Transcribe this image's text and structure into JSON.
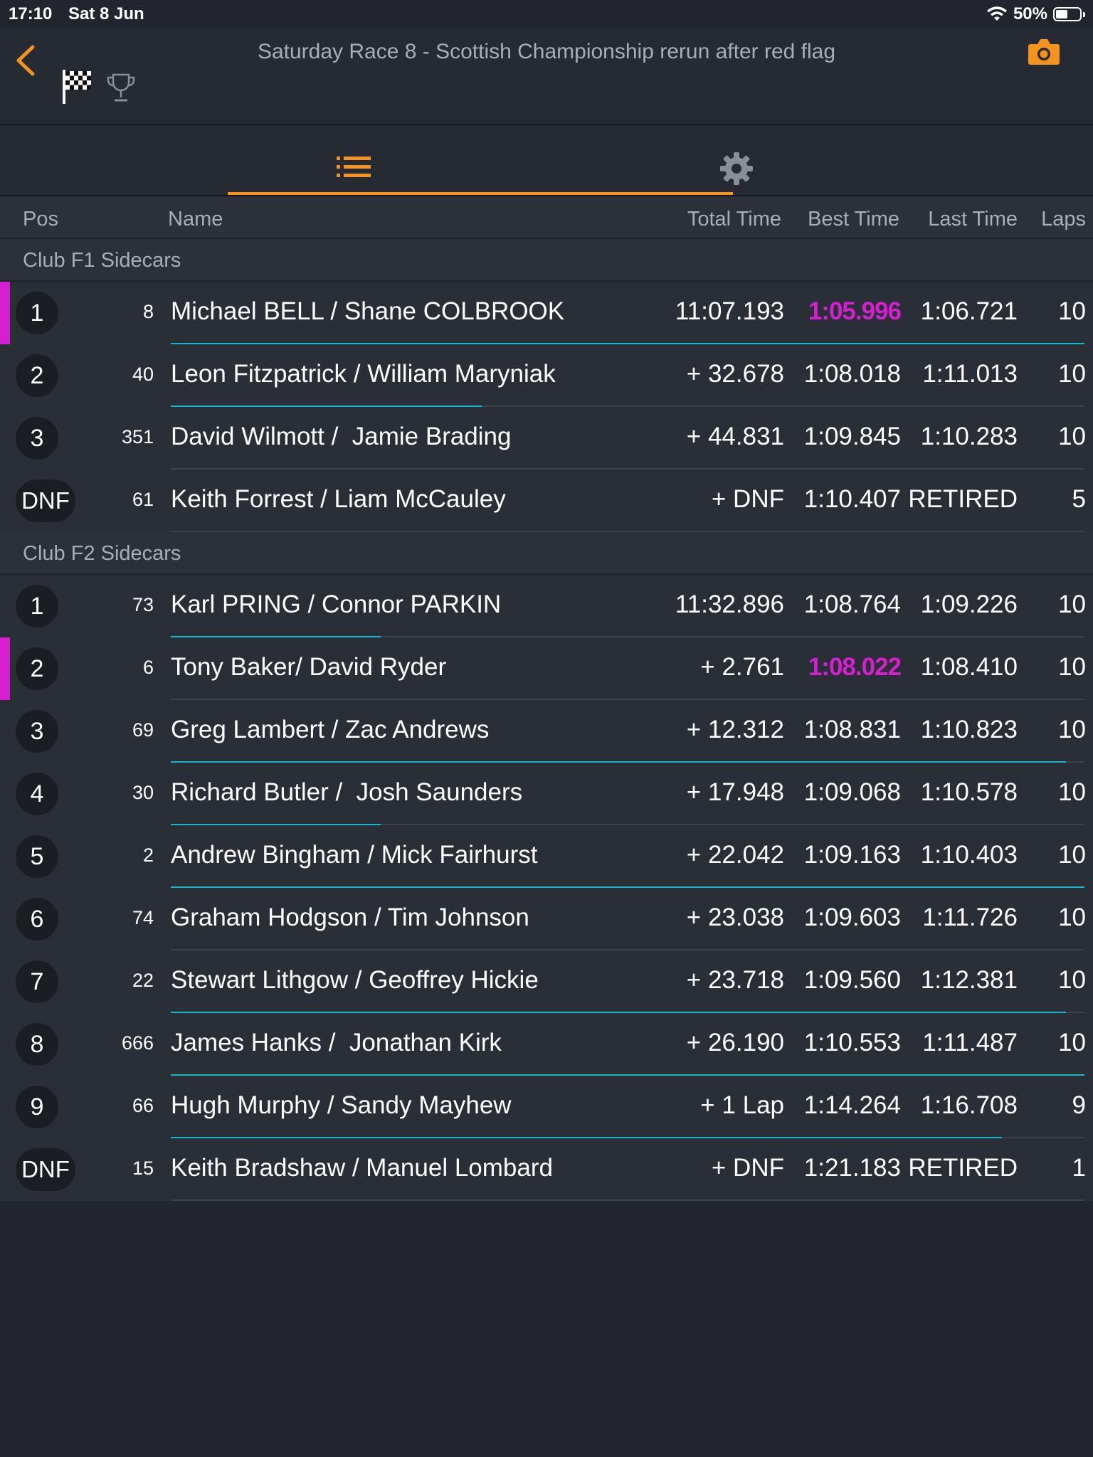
{
  "status": {
    "time": "17:10",
    "date": "Sat 8 Jun",
    "battery": "50%",
    "battery_level": 0.5
  },
  "header": {
    "title": "Saturday Race 8 - Scottish Championship rerun after red flag",
    "accent_color": "#f5931f"
  },
  "columns": {
    "pos": "Pos",
    "name": "Name",
    "total": "Total Time",
    "best": "Best Time",
    "last": "Last Time",
    "laps": "Laps"
  },
  "groups": [
    {
      "title": "Club F1 Sidecars",
      "rows": [
        {
          "pos": "1",
          "num": "8",
          "name": "Michael BELL / Shane COLBROOK",
          "total": "11:07.193",
          "best": "1:05.996",
          "fastest": true,
          "last": "1:06.721",
          "laps": "10",
          "progress": 1.0
        },
        {
          "pos": "2",
          "num": "40",
          "name": "Leon Fitzpatrick / William Maryniak",
          "total": "+ 32.678",
          "best": "1:08.018",
          "fastest": false,
          "last": "1:11.013",
          "laps": "10",
          "progress": 0.34
        },
        {
          "pos": "3",
          "num": "351",
          "name": "David Wilmott /  Jamie Brading",
          "total": "+ 44.831",
          "best": "1:09.845",
          "fastest": false,
          "last": "1:10.283",
          "laps": "10",
          "progress": 0.0
        },
        {
          "pos": "DNF",
          "num": "61",
          "name": "Keith Forrest / Liam McCauley",
          "total": "+ DNF",
          "best": "1:10.407",
          "fastest": false,
          "last": "RETIRED",
          "laps": "5",
          "progress": 0.0
        }
      ]
    },
    {
      "title": "Club F2 Sidecars",
      "rows": [
        {
          "pos": "1",
          "num": "73",
          "name": "Karl PRING / Connor PARKIN",
          "total": "11:32.896",
          "best": "1:08.764",
          "fastest": false,
          "last": "1:09.226",
          "laps": "10",
          "progress": 0.23
        },
        {
          "pos": "2",
          "num": "6",
          "name": "Tony Baker/ David Ryder",
          "total": "+ 2.761",
          "best": "1:08.022",
          "fastest": true,
          "last": "1:08.410",
          "laps": "10",
          "progress": 0.0
        },
        {
          "pos": "3",
          "num": "69",
          "name": "Greg Lambert / Zac Andrews",
          "total": "+ 12.312",
          "best": "1:08.831",
          "fastest": false,
          "last": "1:10.823",
          "laps": "10",
          "progress": 0.98
        },
        {
          "pos": "4",
          "num": "30",
          "name": "Richard Butler /  Josh Saunders",
          "total": "+ 17.948",
          "best": "1:09.068",
          "fastest": false,
          "last": "1:10.578",
          "laps": "10",
          "progress": 0.23
        },
        {
          "pos": "5",
          "num": "2",
          "name": "Andrew Bingham / Mick Fairhurst",
          "total": "+ 22.042",
          "best": "1:09.163",
          "fastest": false,
          "last": "1:10.403",
          "laps": "10",
          "progress": 1.0
        },
        {
          "pos": "6",
          "num": "74",
          "name": "Graham Hodgson / Tim Johnson",
          "total": "+ 23.038",
          "best": "1:09.603",
          "fastest": false,
          "last": "1:11.726",
          "laps": "10",
          "progress": 0.0
        },
        {
          "pos": "7",
          "num": "22",
          "name": "Stewart Lithgow / Geoffrey Hickie",
          "total": "+ 23.718",
          "best": "1:09.560",
          "fastest": false,
          "last": "1:12.381",
          "laps": "10",
          "progress": 0.98
        },
        {
          "pos": "8",
          "num": "666",
          "name": "James Hanks /  Jonathan Kirk",
          "total": "+ 26.190",
          "best": "1:10.553",
          "fastest": false,
          "last": "1:11.487",
          "laps": "10",
          "progress": 1.0
        },
        {
          "pos": "9",
          "num": "66",
          "name": "Hugh Murphy / Sandy Mayhew",
          "total": "+ 1 Lap",
          "best": "1:14.264",
          "fastest": false,
          "last": "1:16.708",
          "laps": "9",
          "progress": 0.91
        },
        {
          "pos": "DNF",
          "num": "15",
          "name": "Keith Bradshaw / Manuel Lombard",
          "total": "+ DNF",
          "best": "1:21.183",
          "fastest": false,
          "last": "RETIRED",
          "laps": "1",
          "progress": 0.0
        }
      ]
    }
  ],
  "colors": {
    "fastest_lap": "#d61fcf",
    "progress": "#15b6cf",
    "accent": "#f5931f"
  }
}
